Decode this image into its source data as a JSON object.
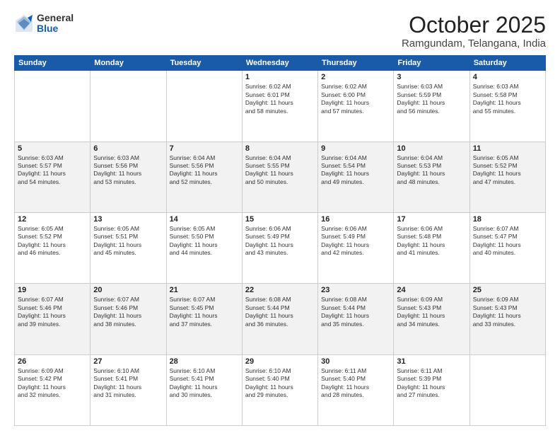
{
  "header": {
    "logo_general": "General",
    "logo_blue": "Blue",
    "month_title": "October 2025",
    "location": "Ramgundam, Telangana, India"
  },
  "weekdays": [
    "Sunday",
    "Monday",
    "Tuesday",
    "Wednesday",
    "Thursday",
    "Friday",
    "Saturday"
  ],
  "weeks": [
    {
      "days": [
        {
          "num": "",
          "info": ""
        },
        {
          "num": "",
          "info": ""
        },
        {
          "num": "",
          "info": ""
        },
        {
          "num": "1",
          "info": "Sunrise: 6:02 AM\nSunset: 6:01 PM\nDaylight: 11 hours\nand 58 minutes."
        },
        {
          "num": "2",
          "info": "Sunrise: 6:02 AM\nSunset: 6:00 PM\nDaylight: 11 hours\nand 57 minutes."
        },
        {
          "num": "3",
          "info": "Sunrise: 6:03 AM\nSunset: 5:59 PM\nDaylight: 11 hours\nand 56 minutes."
        },
        {
          "num": "4",
          "info": "Sunrise: 6:03 AM\nSunset: 5:58 PM\nDaylight: 11 hours\nand 55 minutes."
        }
      ]
    },
    {
      "days": [
        {
          "num": "5",
          "info": "Sunrise: 6:03 AM\nSunset: 5:57 PM\nDaylight: 11 hours\nand 54 minutes."
        },
        {
          "num": "6",
          "info": "Sunrise: 6:03 AM\nSunset: 5:56 PM\nDaylight: 11 hours\nand 53 minutes."
        },
        {
          "num": "7",
          "info": "Sunrise: 6:04 AM\nSunset: 5:56 PM\nDaylight: 11 hours\nand 52 minutes."
        },
        {
          "num": "8",
          "info": "Sunrise: 6:04 AM\nSunset: 5:55 PM\nDaylight: 11 hours\nand 50 minutes."
        },
        {
          "num": "9",
          "info": "Sunrise: 6:04 AM\nSunset: 5:54 PM\nDaylight: 11 hours\nand 49 minutes."
        },
        {
          "num": "10",
          "info": "Sunrise: 6:04 AM\nSunset: 5:53 PM\nDaylight: 11 hours\nand 48 minutes."
        },
        {
          "num": "11",
          "info": "Sunrise: 6:05 AM\nSunset: 5:52 PM\nDaylight: 11 hours\nand 47 minutes."
        }
      ]
    },
    {
      "days": [
        {
          "num": "12",
          "info": "Sunrise: 6:05 AM\nSunset: 5:52 PM\nDaylight: 11 hours\nand 46 minutes."
        },
        {
          "num": "13",
          "info": "Sunrise: 6:05 AM\nSunset: 5:51 PM\nDaylight: 11 hours\nand 45 minutes."
        },
        {
          "num": "14",
          "info": "Sunrise: 6:05 AM\nSunset: 5:50 PM\nDaylight: 11 hours\nand 44 minutes."
        },
        {
          "num": "15",
          "info": "Sunrise: 6:06 AM\nSunset: 5:49 PM\nDaylight: 11 hours\nand 43 minutes."
        },
        {
          "num": "16",
          "info": "Sunrise: 6:06 AM\nSunset: 5:49 PM\nDaylight: 11 hours\nand 42 minutes."
        },
        {
          "num": "17",
          "info": "Sunrise: 6:06 AM\nSunset: 5:48 PM\nDaylight: 11 hours\nand 41 minutes."
        },
        {
          "num": "18",
          "info": "Sunrise: 6:07 AM\nSunset: 5:47 PM\nDaylight: 11 hours\nand 40 minutes."
        }
      ]
    },
    {
      "days": [
        {
          "num": "19",
          "info": "Sunrise: 6:07 AM\nSunset: 5:46 PM\nDaylight: 11 hours\nand 39 minutes."
        },
        {
          "num": "20",
          "info": "Sunrise: 6:07 AM\nSunset: 5:46 PM\nDaylight: 11 hours\nand 38 minutes."
        },
        {
          "num": "21",
          "info": "Sunrise: 6:07 AM\nSunset: 5:45 PM\nDaylight: 11 hours\nand 37 minutes."
        },
        {
          "num": "22",
          "info": "Sunrise: 6:08 AM\nSunset: 5:44 PM\nDaylight: 11 hours\nand 36 minutes."
        },
        {
          "num": "23",
          "info": "Sunrise: 6:08 AM\nSunset: 5:44 PM\nDaylight: 11 hours\nand 35 minutes."
        },
        {
          "num": "24",
          "info": "Sunrise: 6:09 AM\nSunset: 5:43 PM\nDaylight: 11 hours\nand 34 minutes."
        },
        {
          "num": "25",
          "info": "Sunrise: 6:09 AM\nSunset: 5:43 PM\nDaylight: 11 hours\nand 33 minutes."
        }
      ]
    },
    {
      "days": [
        {
          "num": "26",
          "info": "Sunrise: 6:09 AM\nSunset: 5:42 PM\nDaylight: 11 hours\nand 32 minutes."
        },
        {
          "num": "27",
          "info": "Sunrise: 6:10 AM\nSunset: 5:41 PM\nDaylight: 11 hours\nand 31 minutes."
        },
        {
          "num": "28",
          "info": "Sunrise: 6:10 AM\nSunset: 5:41 PM\nDaylight: 11 hours\nand 30 minutes."
        },
        {
          "num": "29",
          "info": "Sunrise: 6:10 AM\nSunset: 5:40 PM\nDaylight: 11 hours\nand 29 minutes."
        },
        {
          "num": "30",
          "info": "Sunrise: 6:11 AM\nSunset: 5:40 PM\nDaylight: 11 hours\nand 28 minutes."
        },
        {
          "num": "31",
          "info": "Sunrise: 6:11 AM\nSunset: 5:39 PM\nDaylight: 11 hours\nand 27 minutes."
        },
        {
          "num": "",
          "info": ""
        }
      ]
    }
  ]
}
